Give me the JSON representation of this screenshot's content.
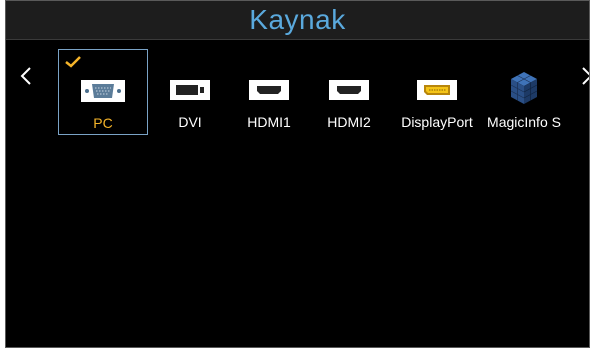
{
  "header": {
    "title": "Kaynak"
  },
  "navigation": {
    "prev_icon": "chevron-left-icon",
    "next_icon": "chevron-right-icon"
  },
  "sources": [
    {
      "label": "PC",
      "icon": "vga-port-icon",
      "selected": true
    },
    {
      "label": "DVI",
      "icon": "dvi-port-icon",
      "selected": false
    },
    {
      "label": "HDMI1",
      "icon": "hdmi-port-icon",
      "selected": false
    },
    {
      "label": "HDMI2",
      "icon": "hdmi-port-icon",
      "selected": false
    },
    {
      "label": "DisplayPort",
      "icon": "displayport-icon",
      "selected": false
    },
    {
      "label": "MagicInfo S",
      "icon": "magicinfo-cube-icon",
      "selected": false
    }
  ],
  "colors": {
    "title": "#5aa9dd",
    "selected_label": "#f5b42a",
    "checkmark": "#f5b42a",
    "selection_border": "#7aa3c6"
  }
}
